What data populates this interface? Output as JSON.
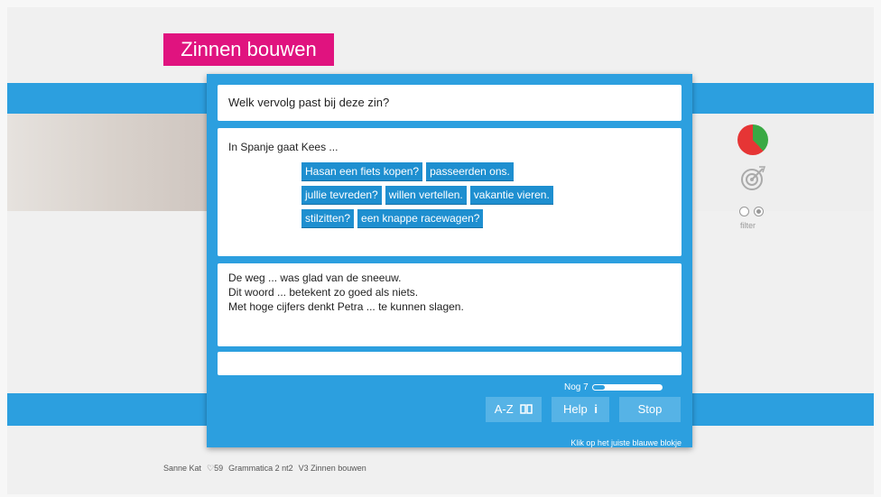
{
  "app": {
    "title": "Zinnen bouwen"
  },
  "question": {
    "text": "Welk vervolg past bij deze zin?"
  },
  "work": {
    "prompt": "In Spanje gaat Kees ...",
    "rows": [
      [
        "Hasan een fiets kopen?",
        "passeerden ons."
      ],
      [
        "jullie tevreden?",
        "willen vertellen.",
        "vakantie vieren."
      ],
      [
        "stilzitten?",
        "een knappe racewagen?"
      ]
    ]
  },
  "examples": [
    "De weg ... was glad van de sneeuw.",
    "Dit woord ... betekent zo goed als niets.",
    "Met hoge cijfers denkt Petra ... te kunnen slagen."
  ],
  "answer": {
    "value": ""
  },
  "progress": {
    "label": "Nog 7",
    "fraction": 0.18
  },
  "buttons": {
    "az": "A-Z",
    "help": "Help",
    "stop": "Stop"
  },
  "hint": "Klik op het juiste blauwe blokje",
  "side": {
    "filter_label": "filter",
    "pie": {
      "green": 0.38,
      "red": 0.62
    }
  },
  "footer": {
    "user": "Sanne Kat",
    "score": "♡59",
    "course": "Grammatica 2 nt2",
    "module": "V3 Zinnen bouwen"
  },
  "colors": {
    "accent": "#2c9fdf",
    "brand": "#e0137f"
  }
}
